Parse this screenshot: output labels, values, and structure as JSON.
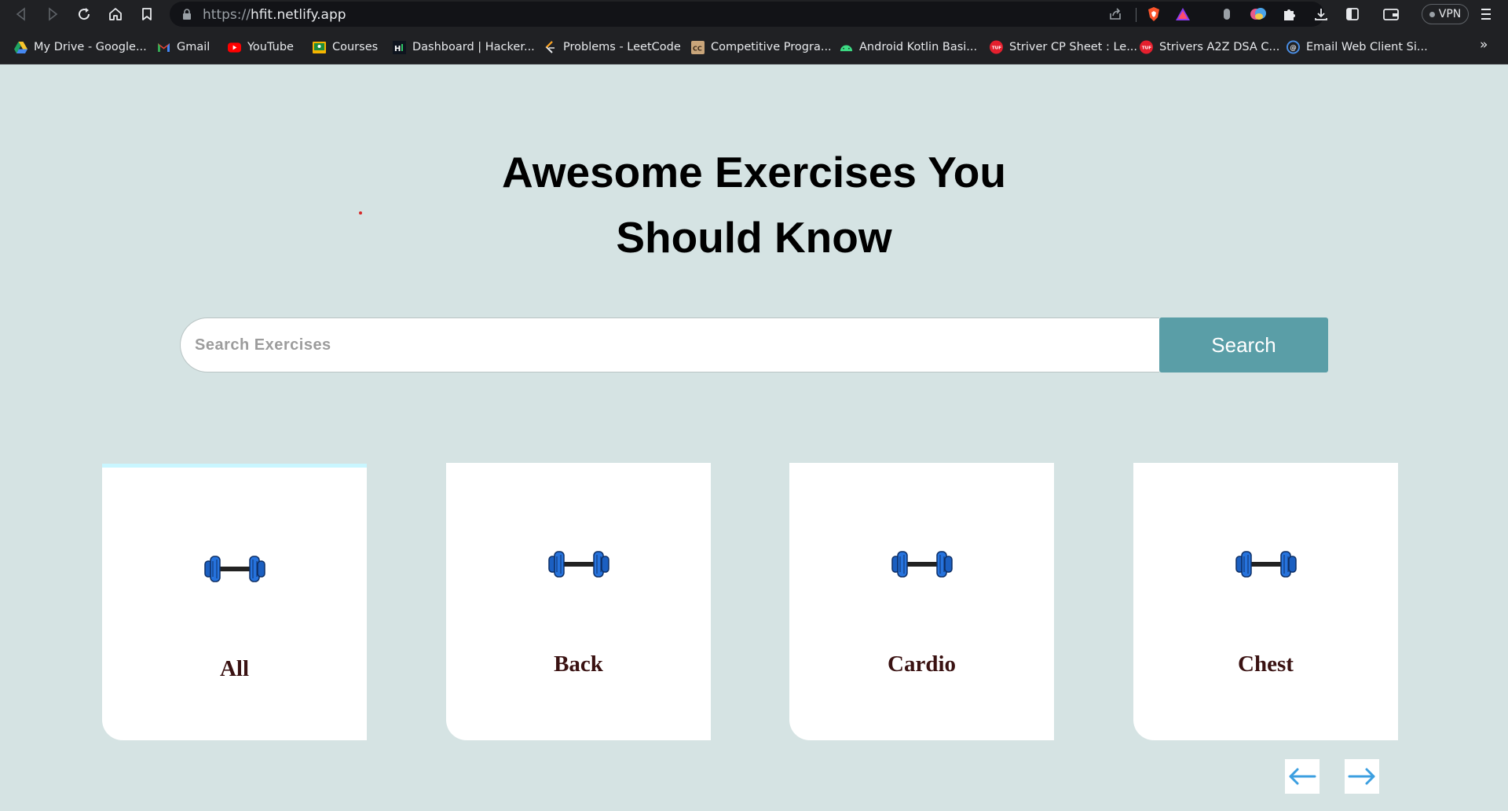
{
  "browser": {
    "url_scheme": "https://",
    "url_host": "hfit.netlify.app",
    "vpn_label": "VPN",
    "bookmarks": [
      {
        "label": "My Drive - Google...",
        "icon": "google-drive-icon"
      },
      {
        "label": "Gmail",
        "icon": "gmail-icon"
      },
      {
        "label": "YouTube",
        "icon": "youtube-icon"
      },
      {
        "label": "Courses",
        "icon": "classroom-icon"
      },
      {
        "label": "Dashboard | Hacker...",
        "icon": "hackerrank-icon"
      },
      {
        "label": "Problems - LeetCode",
        "icon": "leetcode-icon"
      },
      {
        "label": "Competitive Progra...",
        "icon": "codechef-icon"
      },
      {
        "label": "Android Kotlin Basi...",
        "icon": "android-icon"
      },
      {
        "label": "Striver CP Sheet : Le...",
        "icon": "tuf-icon"
      },
      {
        "label": "Strivers A2Z DSA C...",
        "icon": "tuf-icon"
      },
      {
        "label": "Email Web Client Si...",
        "icon": "email-client-icon"
      }
    ],
    "more_label": "»"
  },
  "hero": {
    "line1": "Awesome Exercises You",
    "line2": "Should Know"
  },
  "search": {
    "placeholder": "Search Exercises",
    "value": "",
    "button_label": "Search"
  },
  "categories": [
    {
      "label": "All",
      "icon": "dumbbell-icon",
      "selected": true
    },
    {
      "label": "Back",
      "icon": "dumbbell-icon",
      "selected": false
    },
    {
      "label": "Cardio",
      "icon": "dumbbell-icon",
      "selected": false
    },
    {
      "label": "Chest",
      "icon": "dumbbell-icon",
      "selected": false
    }
  ],
  "pager": {
    "prev_icon": "arrow-left-icon",
    "next_icon": "arrow-right-icon"
  },
  "colors": {
    "page_background": "#d5e3e3",
    "search_button": "#5a9ea7",
    "card_label": "#3a1212",
    "active_card_accent": "#c9f6ff",
    "arrow": "#3c9fe0",
    "dumbbell": "#1b5fc1"
  }
}
